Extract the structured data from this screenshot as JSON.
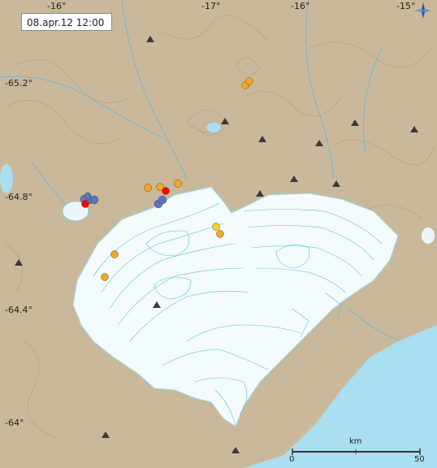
{
  "timestamp": "08.apr.12  12:00",
  "longitude_labels": [
    "-16°",
    "-17°",
    "-16°",
    "-15°"
  ],
  "latitude_labels": [
    "-65.2°",
    "-64.8°",
    "-64.4°",
    "-64°"
  ],
  "scale": {
    "unit": "km",
    "start": "0",
    "end": "50"
  },
  "compass_icon": "compass-icon",
  "colors": {
    "land": "#c9b99a",
    "glacier": "#f4fbfd",
    "glacier_contour": "#4fc3d9",
    "sea": "#a9dff0",
    "quake_old": "#f5a623",
    "quake_recent": "#f5d020",
    "quake_latest": "#ff0000",
    "quake_cluster": "#5b74c9"
  }
}
